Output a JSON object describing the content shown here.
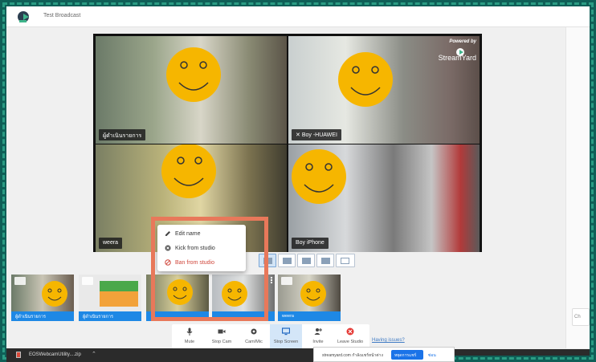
{
  "app": {
    "title": "Test Broadcast"
  },
  "stage": {
    "tiles": [
      {
        "name": "ผู้ดำเนินรายการ"
      },
      {
        "name": "Boy -HUAWEI",
        "muted": true
      },
      {
        "name": "weera"
      },
      {
        "name": "Boy iPhone"
      }
    ],
    "powered_by": "Powered by",
    "brand": "StreamYard"
  },
  "context_menu": {
    "items": [
      {
        "label": "Edit name",
        "icon": "pencil-icon"
      },
      {
        "label": "Kick from studio",
        "icon": "kick-icon"
      },
      {
        "label": "Ban from studio",
        "icon": "ban-icon",
        "danger": true
      }
    ]
  },
  "thumbnails": [
    {
      "label": "ผู้ดำเนินรายการ"
    },
    {
      "label": "ผู้ดำเนินรายการ"
    },
    {
      "label": ""
    },
    {
      "label": ""
    },
    {
      "label": "weera"
    }
  ],
  "controls": [
    {
      "label": "Mute",
      "icon": "microphone-icon"
    },
    {
      "label": "Stop Cam",
      "icon": "camera-icon"
    },
    {
      "label": "Cam/Mic",
      "icon": "gear-icon"
    },
    {
      "label": "Stop Screen",
      "icon": "screen-share-icon",
      "active": true
    },
    {
      "label": "Invite",
      "icon": "add-person-icon"
    },
    {
      "label": "Leave Studio",
      "icon": "leave-icon"
    }
  ],
  "having_issues": "Having issues?",
  "download": {
    "filename": "EOSWebcamUtility....zip"
  },
  "share_bar": {
    "text": "streamyard.com กำลังแชร์หน้าต่าง",
    "stop": "หยุดการแชร์",
    "hide": "ซ่อน"
  },
  "chat_tab": "Ch",
  "colors": {
    "accent": "#1e88e5",
    "highlight": "#e8785a",
    "danger": "#d0473b",
    "face": "#f6b600"
  }
}
